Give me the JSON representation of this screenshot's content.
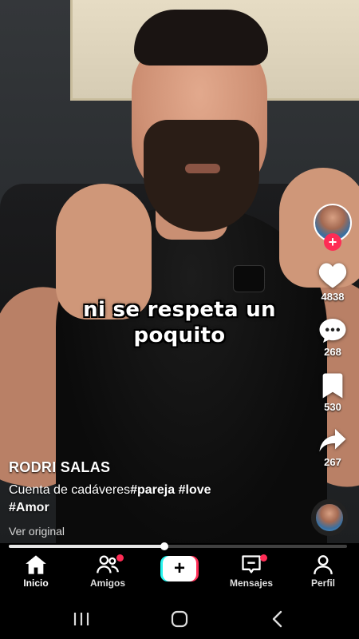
{
  "video": {
    "caption_line1": "ni se respeta un",
    "caption_line2": "poquito",
    "progress_fraction": 0.46
  },
  "side_rail": {
    "avatar_icon": "creator-avatar",
    "follow_icon": "plus-icon",
    "likes": "4838",
    "comments": "268",
    "saves": "530",
    "shares": "267"
  },
  "post": {
    "username": "RODRI SALAS",
    "description_text": "Cuenta de cadáveres",
    "hashtags": [
      "#pareja",
      "#love",
      "#Amor"
    ],
    "translate_link": "Ver original"
  },
  "tabs": [
    {
      "label": "Inicio",
      "icon": "home-icon",
      "active": true,
      "badge": false
    },
    {
      "label": "Amigos",
      "icon": "friends-icon",
      "active": false,
      "badge": true
    },
    {
      "label": "",
      "icon": "create-plus-icon",
      "active": false,
      "badge": false
    },
    {
      "label": "Mensajes",
      "icon": "inbox-icon",
      "active": false,
      "badge": true
    },
    {
      "label": "Perfil",
      "icon": "profile-icon",
      "active": false,
      "badge": false
    }
  ],
  "colors": {
    "accent_red": "#fe2c55",
    "accent_cyan": "#25f4ee",
    "background": "#000000"
  },
  "system_nav": [
    "recents-icon",
    "home-circle-icon",
    "back-icon"
  ]
}
